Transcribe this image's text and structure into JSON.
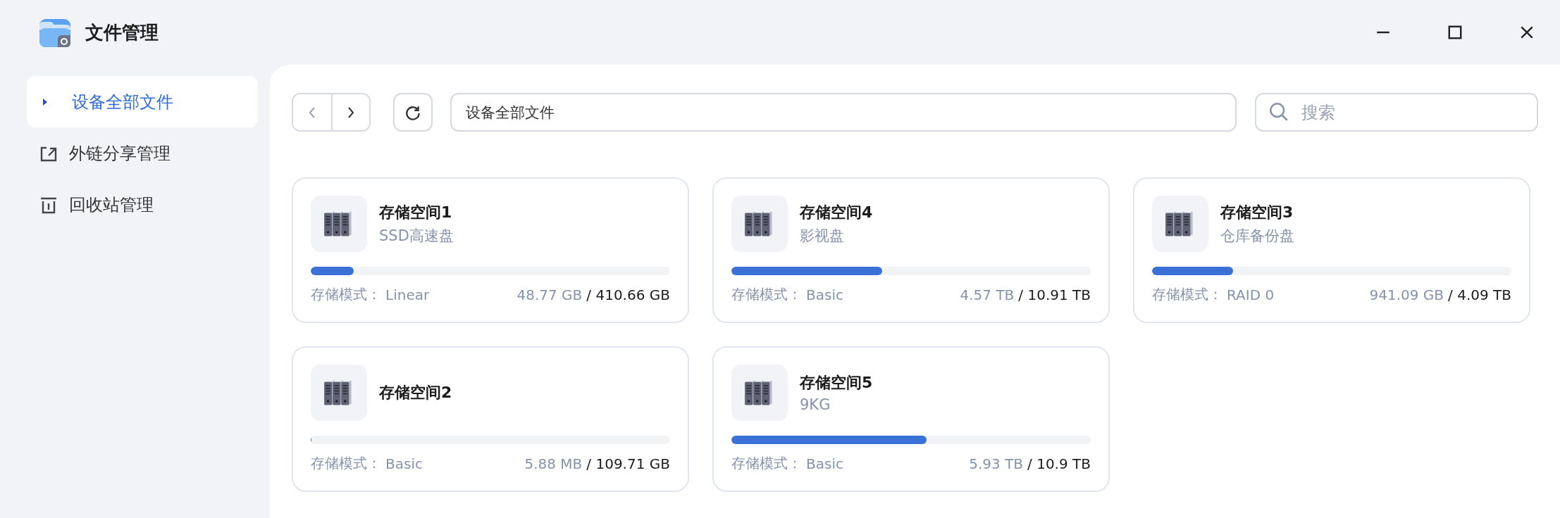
{
  "window": {
    "title": "文件管理"
  },
  "sidebar": {
    "items": [
      {
        "label": "设备全部文件",
        "kind": "current",
        "selected": true
      },
      {
        "label": "外链分享管理",
        "kind": "share",
        "selected": false
      },
      {
        "label": "回收站管理",
        "kind": "trash",
        "selected": false
      }
    ]
  },
  "toolbar": {
    "path": "设备全部文件",
    "search": {
      "placeholder": "搜索"
    }
  },
  "volumes": [
    {
      "name": "存储空间1",
      "subtitle": "SSD高速盘",
      "level": 0.119,
      "mode_label": "存储模式：",
      "mode": "Linear",
      "used": "48.77 GB",
      "total": "/ 410.66 GB"
    },
    {
      "name": "存储空间4",
      "subtitle": "影视盘",
      "level": 0.419,
      "mode_label": "存储模式：",
      "mode": "Basic",
      "used": "4.57 TB",
      "total": "/ 10.91 TB"
    },
    {
      "name": "存储空间3",
      "subtitle": "仓库备份盘",
      "level": 0.225,
      "mode_label": "存储模式：",
      "mode": "RAID 0",
      "used": "941.09 GB",
      "total": "/ 4.09 TB"
    },
    {
      "name": "存储空间2",
      "level": 0.002,
      "mode_label": "存储模式：",
      "mode": "Basic",
      "used": "5.88 MB",
      "total": "/ 109.71 GB"
    },
    {
      "name": "存储空间5",
      "subtitle": "9KG",
      "level": 0.544,
      "mode_label": "存储模式：",
      "mode": "Basic",
      "used": "5.93 TB",
      "total": "/ 10.9 TB"
    }
  ]
}
